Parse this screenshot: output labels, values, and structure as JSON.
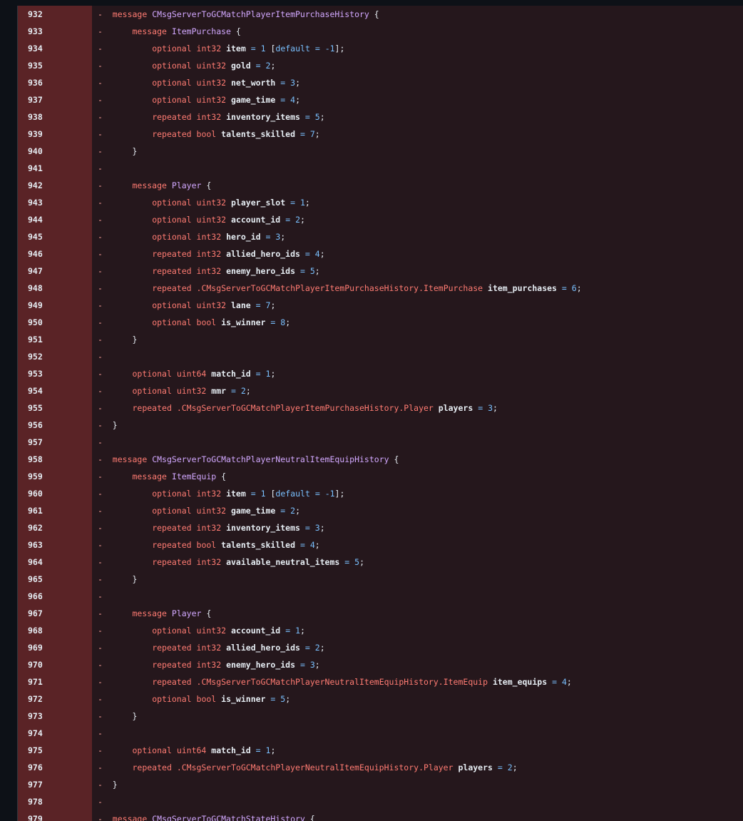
{
  "diff": {
    "rows": [
      {
        "num": "932",
        "mk": "-",
        "in": 0,
        "t": [
          [
            "kw",
            "message"
          ],
          [
            "ty",
            "CMsgServerToGCMatchPlayerItemPurchaseHistory"
          ],
          [
            "pu",
            "{"
          ]
        ]
      },
      {
        "num": "933",
        "mk": "-",
        "in": 1,
        "t": [
          [
            "kw",
            "message"
          ],
          [
            "ty",
            "ItemPurchase"
          ],
          [
            "pu",
            "{"
          ]
        ]
      },
      {
        "num": "934",
        "mk": "-",
        "in": 2,
        "t": [
          [
            "kw",
            "optional"
          ],
          [
            "kw",
            "int32"
          ],
          [
            "id",
            "item"
          ],
          [
            "op",
            "="
          ],
          [
            "nm",
            "1"
          ],
          [
            "pu",
            "["
          ],
          [
            "nm",
            "default"
          ],
          [
            "op",
            "="
          ],
          [
            "nm",
            "-1"
          ],
          [
            "pu",
            "];"
          ]
        ]
      },
      {
        "num": "935",
        "mk": "-",
        "in": 2,
        "t": [
          [
            "kw",
            "optional"
          ],
          [
            "kw",
            "uint32"
          ],
          [
            "id",
            "gold"
          ],
          [
            "op",
            "="
          ],
          [
            "nm",
            "2"
          ],
          [
            "pu",
            ";"
          ]
        ]
      },
      {
        "num": "936",
        "mk": "-",
        "in": 2,
        "t": [
          [
            "kw",
            "optional"
          ],
          [
            "kw",
            "uint32"
          ],
          [
            "id",
            "net_worth"
          ],
          [
            "op",
            "="
          ],
          [
            "nm",
            "3"
          ],
          [
            "pu",
            ";"
          ]
        ]
      },
      {
        "num": "937",
        "mk": "-",
        "in": 2,
        "t": [
          [
            "kw",
            "optional"
          ],
          [
            "kw",
            "uint32"
          ],
          [
            "id",
            "game_time"
          ],
          [
            "op",
            "="
          ],
          [
            "nm",
            "4"
          ],
          [
            "pu",
            ";"
          ]
        ]
      },
      {
        "num": "938",
        "mk": "-",
        "in": 2,
        "t": [
          [
            "kw",
            "repeated"
          ],
          [
            "kw",
            "int32"
          ],
          [
            "id",
            "inventory_items"
          ],
          [
            "op",
            "="
          ],
          [
            "nm",
            "5"
          ],
          [
            "pu",
            ";"
          ]
        ]
      },
      {
        "num": "939",
        "mk": "-",
        "in": 2,
        "t": [
          [
            "kw",
            "repeated"
          ],
          [
            "kw",
            "bool"
          ],
          [
            "id",
            "talents_skilled"
          ],
          [
            "op",
            "="
          ],
          [
            "nm",
            "7"
          ],
          [
            "pu",
            ";"
          ]
        ]
      },
      {
        "num": "940",
        "mk": "-",
        "in": 1,
        "t": [
          [
            "pu",
            "}"
          ]
        ]
      },
      {
        "num": "941",
        "mk": "-",
        "in": 0,
        "t": []
      },
      {
        "num": "942",
        "mk": "-",
        "in": 1,
        "t": [
          [
            "kw",
            "message"
          ],
          [
            "ty",
            "Player"
          ],
          [
            "pu",
            "{"
          ]
        ]
      },
      {
        "num": "943",
        "mk": "-",
        "in": 2,
        "t": [
          [
            "kw",
            "optional"
          ],
          [
            "kw",
            "uint32"
          ],
          [
            "id",
            "player_slot"
          ],
          [
            "op",
            "="
          ],
          [
            "nm",
            "1"
          ],
          [
            "pu",
            ";"
          ]
        ]
      },
      {
        "num": "944",
        "mk": "-",
        "in": 2,
        "t": [
          [
            "kw",
            "optional"
          ],
          [
            "kw",
            "uint32"
          ],
          [
            "id",
            "account_id"
          ],
          [
            "op",
            "="
          ],
          [
            "nm",
            "2"
          ],
          [
            "pu",
            ";"
          ]
        ]
      },
      {
        "num": "945",
        "mk": "-",
        "in": 2,
        "t": [
          [
            "kw",
            "optional"
          ],
          [
            "kw",
            "int32"
          ],
          [
            "id",
            "hero_id"
          ],
          [
            "op",
            "="
          ],
          [
            "nm",
            "3"
          ],
          [
            "pu",
            ";"
          ]
        ]
      },
      {
        "num": "946",
        "mk": "-",
        "in": 2,
        "t": [
          [
            "kw",
            "repeated"
          ],
          [
            "kw",
            "int32"
          ],
          [
            "id",
            "allied_hero_ids"
          ],
          [
            "op",
            "="
          ],
          [
            "nm",
            "4"
          ],
          [
            "pu",
            ";"
          ]
        ]
      },
      {
        "num": "947",
        "mk": "-",
        "in": 2,
        "t": [
          [
            "kw",
            "repeated"
          ],
          [
            "kw",
            "int32"
          ],
          [
            "id",
            "enemy_hero_ids"
          ],
          [
            "op",
            "="
          ],
          [
            "nm",
            "5"
          ],
          [
            "pu",
            ";"
          ]
        ]
      },
      {
        "num": "948",
        "mk": "-",
        "in": 2,
        "t": [
          [
            "kw",
            "repeated"
          ],
          [
            "kw",
            ".CMsgServerToGCMatchPlayerItemPurchaseHistory.ItemPurchase"
          ],
          [
            "id",
            "item_purchases"
          ],
          [
            "op",
            "="
          ],
          [
            "nm",
            "6"
          ],
          [
            "pu",
            ";"
          ]
        ]
      },
      {
        "num": "949",
        "mk": "-",
        "in": 2,
        "t": [
          [
            "kw",
            "optional"
          ],
          [
            "kw",
            "uint32"
          ],
          [
            "id",
            "lane"
          ],
          [
            "op",
            "="
          ],
          [
            "nm",
            "7"
          ],
          [
            "pu",
            ";"
          ]
        ]
      },
      {
        "num": "950",
        "mk": "-",
        "in": 2,
        "t": [
          [
            "kw",
            "optional"
          ],
          [
            "kw",
            "bool"
          ],
          [
            "id",
            "is_winner"
          ],
          [
            "op",
            "="
          ],
          [
            "nm",
            "8"
          ],
          [
            "pu",
            ";"
          ]
        ]
      },
      {
        "num": "951",
        "mk": "-",
        "in": 1,
        "t": [
          [
            "pu",
            "}"
          ]
        ]
      },
      {
        "num": "952",
        "mk": "-",
        "in": 0,
        "t": []
      },
      {
        "num": "953",
        "mk": "-",
        "in": 1,
        "t": [
          [
            "kw",
            "optional"
          ],
          [
            "kw",
            "uint64"
          ],
          [
            "id",
            "match_id"
          ],
          [
            "op",
            "="
          ],
          [
            "nm",
            "1"
          ],
          [
            "pu",
            ";"
          ]
        ]
      },
      {
        "num": "954",
        "mk": "-",
        "in": 1,
        "t": [
          [
            "kw",
            "optional"
          ],
          [
            "kw",
            "uint32"
          ],
          [
            "id",
            "mmr"
          ],
          [
            "op",
            "="
          ],
          [
            "nm",
            "2"
          ],
          [
            "pu",
            ";"
          ]
        ]
      },
      {
        "num": "955",
        "mk": "-",
        "in": 1,
        "t": [
          [
            "kw",
            "repeated"
          ],
          [
            "kw",
            ".CMsgServerToGCMatchPlayerItemPurchaseHistory.Player"
          ],
          [
            "id",
            "players"
          ],
          [
            "op",
            "="
          ],
          [
            "nm",
            "3"
          ],
          [
            "pu",
            ";"
          ]
        ]
      },
      {
        "num": "956",
        "mk": "-",
        "in": 0,
        "t": [
          [
            "pu",
            "}"
          ]
        ]
      },
      {
        "num": "957",
        "mk": "-",
        "in": 0,
        "t": []
      },
      {
        "num": "958",
        "mk": "-",
        "in": 0,
        "t": [
          [
            "kw",
            "message"
          ],
          [
            "ty",
            "CMsgServerToGCMatchPlayerNeutralItemEquipHistory"
          ],
          [
            "pu",
            "{"
          ]
        ]
      },
      {
        "num": "959",
        "mk": "-",
        "in": 1,
        "t": [
          [
            "kw",
            "message"
          ],
          [
            "ty",
            "ItemEquip"
          ],
          [
            "pu",
            "{"
          ]
        ]
      },
      {
        "num": "960",
        "mk": "-",
        "in": 2,
        "t": [
          [
            "kw",
            "optional"
          ],
          [
            "kw",
            "int32"
          ],
          [
            "id",
            "item"
          ],
          [
            "op",
            "="
          ],
          [
            "nm",
            "1"
          ],
          [
            "pu",
            "["
          ],
          [
            "nm",
            "default"
          ],
          [
            "op",
            "="
          ],
          [
            "nm",
            "-1"
          ],
          [
            "pu",
            "];"
          ]
        ]
      },
      {
        "num": "961",
        "mk": "-",
        "in": 2,
        "t": [
          [
            "kw",
            "optional"
          ],
          [
            "kw",
            "uint32"
          ],
          [
            "id",
            "game_time"
          ],
          [
            "op",
            "="
          ],
          [
            "nm",
            "2"
          ],
          [
            "pu",
            ";"
          ]
        ]
      },
      {
        "num": "962",
        "mk": "-",
        "in": 2,
        "t": [
          [
            "kw",
            "repeated"
          ],
          [
            "kw",
            "int32"
          ],
          [
            "id",
            "inventory_items"
          ],
          [
            "op",
            "="
          ],
          [
            "nm",
            "3"
          ],
          [
            "pu",
            ";"
          ]
        ]
      },
      {
        "num": "963",
        "mk": "-",
        "in": 2,
        "t": [
          [
            "kw",
            "repeated"
          ],
          [
            "kw",
            "bool"
          ],
          [
            "id",
            "talents_skilled"
          ],
          [
            "op",
            "="
          ],
          [
            "nm",
            "4"
          ],
          [
            "pu",
            ";"
          ]
        ]
      },
      {
        "num": "964",
        "mk": "-",
        "in": 2,
        "t": [
          [
            "kw",
            "repeated"
          ],
          [
            "kw",
            "int32"
          ],
          [
            "id",
            "available_neutral_items"
          ],
          [
            "op",
            "="
          ],
          [
            "nm",
            "5"
          ],
          [
            "pu",
            ";"
          ]
        ]
      },
      {
        "num": "965",
        "mk": "-",
        "in": 1,
        "t": [
          [
            "pu",
            "}"
          ]
        ]
      },
      {
        "num": "966",
        "mk": "-",
        "in": 0,
        "t": []
      },
      {
        "num": "967",
        "mk": "-",
        "in": 1,
        "t": [
          [
            "kw",
            "message"
          ],
          [
            "ty",
            "Player"
          ],
          [
            "pu",
            "{"
          ]
        ]
      },
      {
        "num": "968",
        "mk": "-",
        "in": 2,
        "t": [
          [
            "kw",
            "optional"
          ],
          [
            "kw",
            "uint32"
          ],
          [
            "id",
            "account_id"
          ],
          [
            "op",
            "="
          ],
          [
            "nm",
            "1"
          ],
          [
            "pu",
            ";"
          ]
        ]
      },
      {
        "num": "969",
        "mk": "-",
        "in": 2,
        "t": [
          [
            "kw",
            "repeated"
          ],
          [
            "kw",
            "int32"
          ],
          [
            "id",
            "allied_hero_ids"
          ],
          [
            "op",
            "="
          ],
          [
            "nm",
            "2"
          ],
          [
            "pu",
            ";"
          ]
        ]
      },
      {
        "num": "970",
        "mk": "-",
        "in": 2,
        "t": [
          [
            "kw",
            "repeated"
          ],
          [
            "kw",
            "int32"
          ],
          [
            "id",
            "enemy_hero_ids"
          ],
          [
            "op",
            "="
          ],
          [
            "nm",
            "3"
          ],
          [
            "pu",
            ";"
          ]
        ]
      },
      {
        "num": "971",
        "mk": "-",
        "in": 2,
        "t": [
          [
            "kw",
            "repeated"
          ],
          [
            "kw",
            ".CMsgServerToGCMatchPlayerNeutralItemEquipHistory.ItemEquip"
          ],
          [
            "id",
            "item_equips"
          ],
          [
            "op",
            "="
          ],
          [
            "nm",
            "4"
          ],
          [
            "pu",
            ";"
          ]
        ]
      },
      {
        "num": "972",
        "mk": "-",
        "in": 2,
        "t": [
          [
            "kw",
            "optional"
          ],
          [
            "kw",
            "bool"
          ],
          [
            "id",
            "is_winner"
          ],
          [
            "op",
            "="
          ],
          [
            "nm",
            "5"
          ],
          [
            "pu",
            ";"
          ]
        ]
      },
      {
        "num": "973",
        "mk": "-",
        "in": 1,
        "t": [
          [
            "pu",
            "}"
          ]
        ]
      },
      {
        "num": "974",
        "mk": "-",
        "in": 0,
        "t": []
      },
      {
        "num": "975",
        "mk": "-",
        "in": 1,
        "t": [
          [
            "kw",
            "optional"
          ],
          [
            "kw",
            "uint64"
          ],
          [
            "id",
            "match_id"
          ],
          [
            "op",
            "="
          ],
          [
            "nm",
            "1"
          ],
          [
            "pu",
            ";"
          ]
        ]
      },
      {
        "num": "976",
        "mk": "-",
        "in": 1,
        "t": [
          [
            "kw",
            "repeated"
          ],
          [
            "kw",
            ".CMsgServerToGCMatchPlayerNeutralItemEquipHistory.Player"
          ],
          [
            "id",
            "players"
          ],
          [
            "op",
            "="
          ],
          [
            "nm",
            "2"
          ],
          [
            "pu",
            ";"
          ]
        ]
      },
      {
        "num": "977",
        "mk": "-",
        "in": 0,
        "t": [
          [
            "pu",
            "}"
          ]
        ]
      },
      {
        "num": "978",
        "mk": "-",
        "in": 0,
        "t": []
      },
      {
        "num": "979",
        "mk": "-",
        "in": 0,
        "t": [
          [
            "kw",
            "message"
          ],
          [
            "ty",
            "CMsgServerToGCMatchStateHistory"
          ],
          [
            "pu",
            "{"
          ]
        ]
      }
    ]
  }
}
